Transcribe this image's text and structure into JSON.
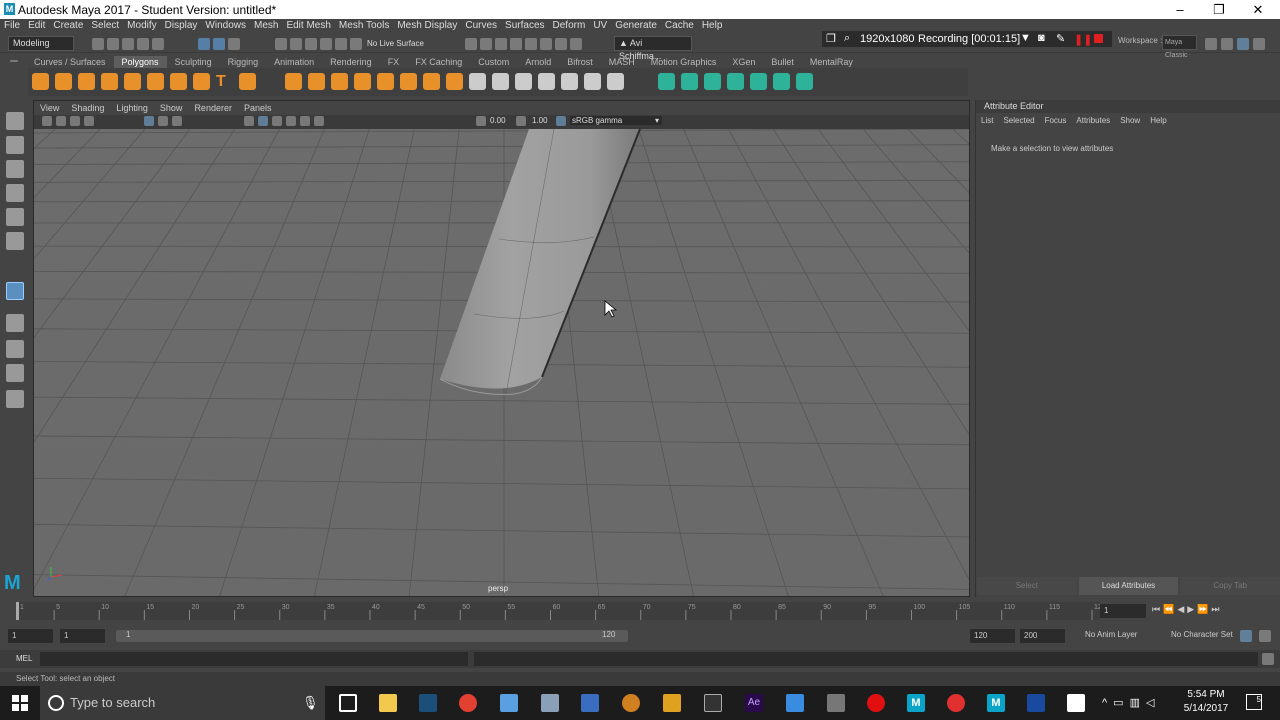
{
  "window": {
    "title": "Autodesk Maya 2017 - Student Version: untitled*"
  },
  "menubar": [
    "File",
    "Edit",
    "Create",
    "Select",
    "Modify",
    "Display",
    "Windows",
    "Mesh",
    "Edit Mesh",
    "Mesh Tools",
    "Mesh Display",
    "Curves",
    "Surfaces",
    "Deform",
    "UV",
    "Generate",
    "Cache",
    "Help"
  ],
  "status": {
    "mode": "Modeling",
    "live_surface": "No Live Surface",
    "user": "Avi Schiffma...",
    "workspace_label": "Workspace :",
    "workspace": "Maya Classic"
  },
  "recording": {
    "resolution": "1920x1080",
    "label": "Recording [00:01:15]"
  },
  "shelf_tabs": [
    "Curves / Surfaces",
    "Polygons",
    "Sculpting",
    "Rigging",
    "Animation",
    "Rendering",
    "FX",
    "FX Caching",
    "Custom",
    "Arnold",
    "Bifrost",
    "MASH",
    "Motion Graphics",
    "XGen",
    "Bullet",
    "MentalRay"
  ],
  "active_shelf": "Polygons",
  "viewport": {
    "menu": [
      "View",
      "Shading",
      "Lighting",
      "Show",
      "Renderer",
      "Panels"
    ],
    "exposure": "0.00",
    "gamma": "1.00",
    "color_space": "sRGB gamma",
    "camera": "persp"
  },
  "attribute_editor": {
    "title": "Attribute Editor",
    "menu": [
      "List",
      "Selected",
      "Focus",
      "Attributes",
      "Show",
      "Help"
    ],
    "message": "Make a selection to view attributes",
    "buttons": [
      "Select",
      "Load Attributes",
      "Copy Tab"
    ]
  },
  "time_slider": {
    "ticks": [
      "1",
      "5",
      "10",
      "15",
      "20",
      "25",
      "30",
      "35",
      "40",
      "45",
      "50",
      "55",
      "60",
      "65",
      "70",
      "75",
      "80",
      "85",
      "90",
      "95",
      "100",
      "105",
      "110",
      "115",
      "120"
    ],
    "current_frame": "1"
  },
  "range": {
    "start": "1",
    "playback_start": "1",
    "range_start_label": "1",
    "range_end_label": "120",
    "playback_end": "120",
    "end": "200",
    "anim_layer": "No Anim Layer",
    "character_set": "No Character Set"
  },
  "command_line": {
    "label": "MEL"
  },
  "help_line": "Select Tool: select an object",
  "taskbar": {
    "search_placeholder": "Type to search",
    "time": "5:54 PM",
    "date": "5/14/2017",
    "notifications": "5"
  }
}
